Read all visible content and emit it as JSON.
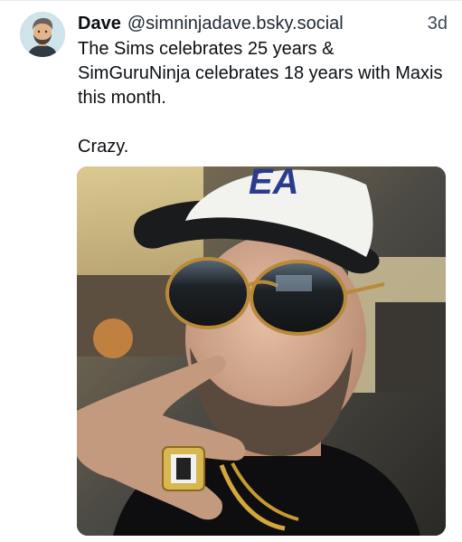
{
  "post": {
    "author_name": "Dave",
    "author_handle": "@simninjadave.bsky.social",
    "timestamp": "3d",
    "text_line1": "The Sims celebrates 25 years & SimGuruNinja celebrates 18 years with Maxis this month.",
    "text_line2": "Crazy.",
    "avatar_icon": "cartoon-man-avatar",
    "image": {
      "subject": "selfie-man-ea-cap-aviator-sunglasses",
      "cap_logo": "EA"
    }
  }
}
